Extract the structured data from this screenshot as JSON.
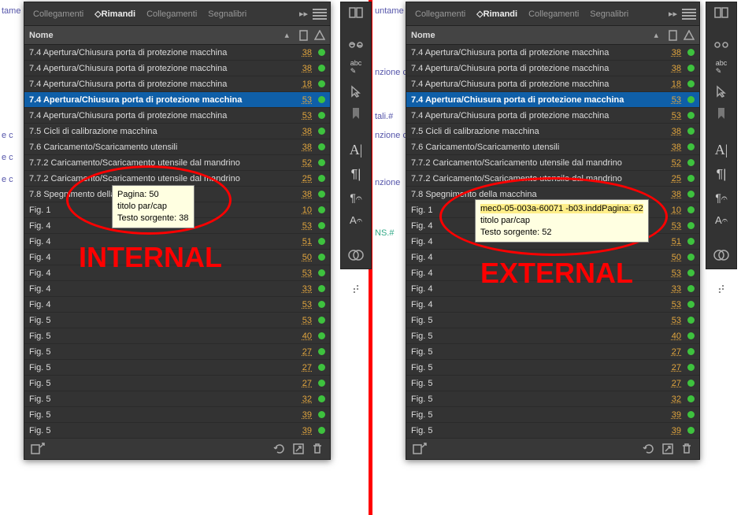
{
  "tabs": {
    "t1": "Collegamenti",
    "t2": "Rimandi",
    "t3": "Collegamenti",
    "t4": "Segnalibri"
  },
  "header": {
    "name": "Nome"
  },
  "annot": {
    "left": "INTERNAL",
    "right": "EXTERNAL"
  },
  "tooltip_left": {
    "l1": "Pagina: 50",
    "l2": "titolo par/cap",
    "l3": "Testo sorgente: 38"
  },
  "tooltip_right": {
    "l1": "mec0-05-003a-60071 -b03.inddPagina: 62",
    "l2": "titolo par/cap",
    "l3": "Testo sorgente: 52"
  },
  "bgtext": {
    "t1": "tame",
    "t2": "e c",
    "t3": "e c",
    "t4": "e c",
    "r1": "untame",
    "r2": "nzione c",
    "r3": "tali.#",
    "r4": "nzione c",
    "r5": "nzione",
    "r6": "NS.#"
  },
  "rows": [
    {
      "label": "7.4 Apertura/Chiusura porta di protezione macchina",
      "pg": "38"
    },
    {
      "label": "7.4 Apertura/Chiusura porta di protezione macchina",
      "pg": "38"
    },
    {
      "label": "7.4 Apertura/Chiusura porta di protezione macchina",
      "pg": "18"
    },
    {
      "label": "7.4 Apertura/Chiusura porta di protezione macchina",
      "pg": "53",
      "sel": true
    },
    {
      "label": "7.4 Apertura/Chiusura porta di protezione macchina",
      "pg": "53"
    },
    {
      "label": "7.5 Cicli di calibrazione macchina",
      "pg": "38"
    },
    {
      "label": "7.6 Caricamento/Scaricamento utensili",
      "pg": "38"
    },
    {
      "label": "7.7.2 Caricamento/Scaricamento utensile dal mandrino",
      "pg": "52"
    },
    {
      "label": "7.7.2 Caricamento/Scaricamento utensile dal mandrino",
      "pg": "25"
    },
    {
      "label": "7.8 Spegnimento della macchina",
      "pg": "38"
    },
    {
      "label": "Fig. 1",
      "pg": "10"
    },
    {
      "label": "Fig. 4",
      "pg": "53"
    },
    {
      "label": "Fig. 4",
      "pg": "51"
    },
    {
      "label": "Fig. 4",
      "pg": "50"
    },
    {
      "label": "Fig. 4",
      "pg": "53"
    },
    {
      "label": "Fig. 4",
      "pg": "33"
    },
    {
      "label": "Fig. 4",
      "pg": "53"
    },
    {
      "label": "Fig. 5",
      "pg": "53"
    },
    {
      "label": "Fig. 5",
      "pg": "40"
    },
    {
      "label": "Fig. 5",
      "pg": "27"
    },
    {
      "label": "Fig. 5",
      "pg": "27"
    },
    {
      "label": "Fig. 5",
      "pg": "27"
    },
    {
      "label": "Fig. 5",
      "pg": "32"
    },
    {
      "label": "Fig. 5",
      "pg": "39"
    },
    {
      "label": "Fig. 5",
      "pg": "39"
    }
  ],
  "chart_data": null
}
